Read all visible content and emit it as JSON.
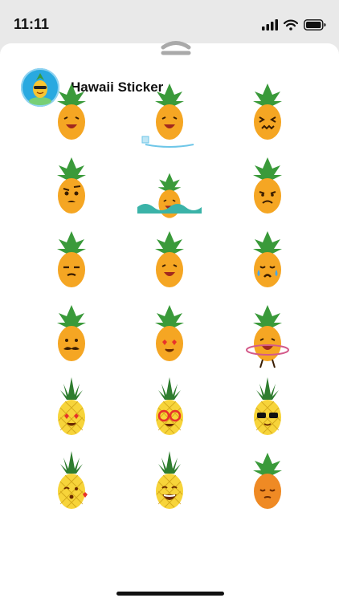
{
  "status_bar": {
    "time": "11:11",
    "icons": [
      "signal-icon",
      "wifi-icon",
      "battery-icon"
    ]
  },
  "header": {
    "title": "Hawaii Sticker",
    "icon": "pineapple-app-icon"
  },
  "stickers": [
    {
      "name": "laughing",
      "variant": "leafy"
    },
    {
      "name": "ice-skating",
      "variant": "leafy"
    },
    {
      "name": "wince",
      "variant": "leafy"
    },
    {
      "name": "raised-eyebrow",
      "variant": "leafy"
    },
    {
      "name": "swimming",
      "variant": "leafy"
    },
    {
      "name": "sad",
      "variant": "leafy"
    },
    {
      "name": "frown",
      "variant": "leafy"
    },
    {
      "name": "laughing-2",
      "variant": "leafy"
    },
    {
      "name": "crying",
      "variant": "leafy"
    },
    {
      "name": "mustache",
      "variant": "leafy"
    },
    {
      "name": "heart-eyes",
      "variant": "leafy"
    },
    {
      "name": "hula-hoop",
      "variant": "leafy"
    },
    {
      "name": "heart-eyes-spiky",
      "variant": "spiky"
    },
    {
      "name": "glasses-spiky",
      "variant": "spiky"
    },
    {
      "name": "sunglasses-spiky",
      "variant": "spiky"
    },
    {
      "name": "kiss-spiky",
      "variant": "spiky"
    },
    {
      "name": "big-smile-spiky",
      "variant": "spiky"
    },
    {
      "name": "sleepy-orange",
      "variant": "orange"
    }
  ],
  "colors": {
    "pineapple": "#f5a623",
    "pineapple_yellow": "#f7d43a",
    "leaf": "#3a9a3a",
    "app_icon_bg": "#29a9e0"
  }
}
